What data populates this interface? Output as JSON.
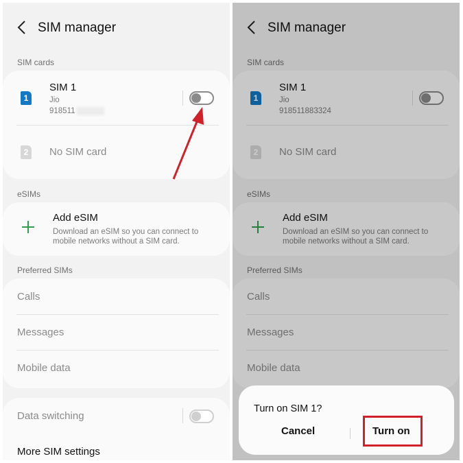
{
  "screen": {
    "title": "SIM manager",
    "sections": {
      "sim_cards": "SIM cards",
      "esims": "eSIMs",
      "preferred": "Preferred SIMs"
    },
    "sim1": {
      "name": "SIM 1",
      "carrier": "Jio",
      "number_left": "918511",
      "number_right": "918511883324",
      "slot": "1"
    },
    "sim2": {
      "slot": "2",
      "label": "No SIM card"
    },
    "add_esim": {
      "title": "Add eSIM",
      "description": "Download an eSIM so you can connect to mobile networks without a SIM card."
    },
    "preferred_items": [
      "Calls",
      "Messages",
      "Mobile data"
    ],
    "data_switching": "Data switching",
    "more_settings": "More SIM settings"
  },
  "dialog": {
    "title": "Turn on SIM 1?",
    "cancel": "Cancel",
    "confirm": "Turn on"
  },
  "colors": {
    "accent_blue": "#1479c5",
    "plus_green": "#2e9e4e",
    "annotation_red": "#d0202a"
  },
  "icons": {
    "back": "chevron-left-icon",
    "sim": "sim-card-icon",
    "add": "plus-icon"
  }
}
